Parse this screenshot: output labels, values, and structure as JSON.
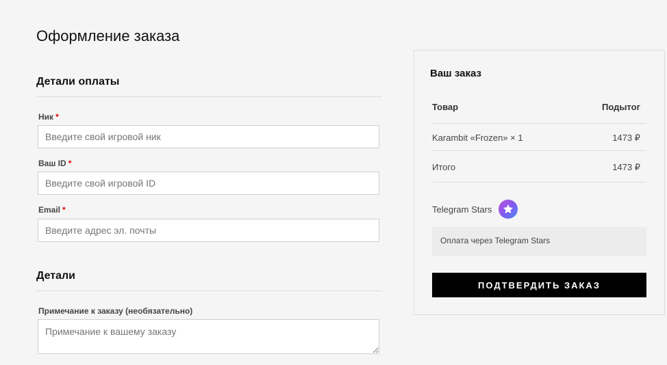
{
  "page": {
    "title": "Оформление заказа"
  },
  "billing": {
    "title": "Детали оплаты",
    "fields": [
      {
        "label": "Ник",
        "required_mark": "*",
        "placeholder": "Введите свой игровой ник"
      },
      {
        "label": "Ваш ID",
        "required_mark": "*",
        "placeholder": "Введите свой игровой ID"
      },
      {
        "label": "Email",
        "required_mark": "*",
        "placeholder": "Введите адрес эл. почты"
      }
    ]
  },
  "details": {
    "title": "Детали",
    "note_label": "Примечание к заказу (необязательно)",
    "note_placeholder": "Примечание к вашему заказу"
  },
  "order": {
    "title": "Ваш заказ",
    "col_product": "Товар",
    "col_subtotal": "Подытог",
    "item_name": "Karambit «Frozen» × 1",
    "item_price": "1473 ₽",
    "total_label": "Итого",
    "total_price": "1473 ₽",
    "payment_method": "Telegram Stars",
    "payment_icon": "telegram-star-icon",
    "payment_description": "Оплата через Telegram Stars",
    "confirm_label": "ПОДТВЕРДИТЬ ЗАКАЗ"
  },
  "colors": {
    "background": "#f5f5f5",
    "required": "#dd0000",
    "button": "#000000",
    "star_gradient": [
      "#c04fd9",
      "#7c5cf0",
      "#4e8ef7"
    ]
  }
}
